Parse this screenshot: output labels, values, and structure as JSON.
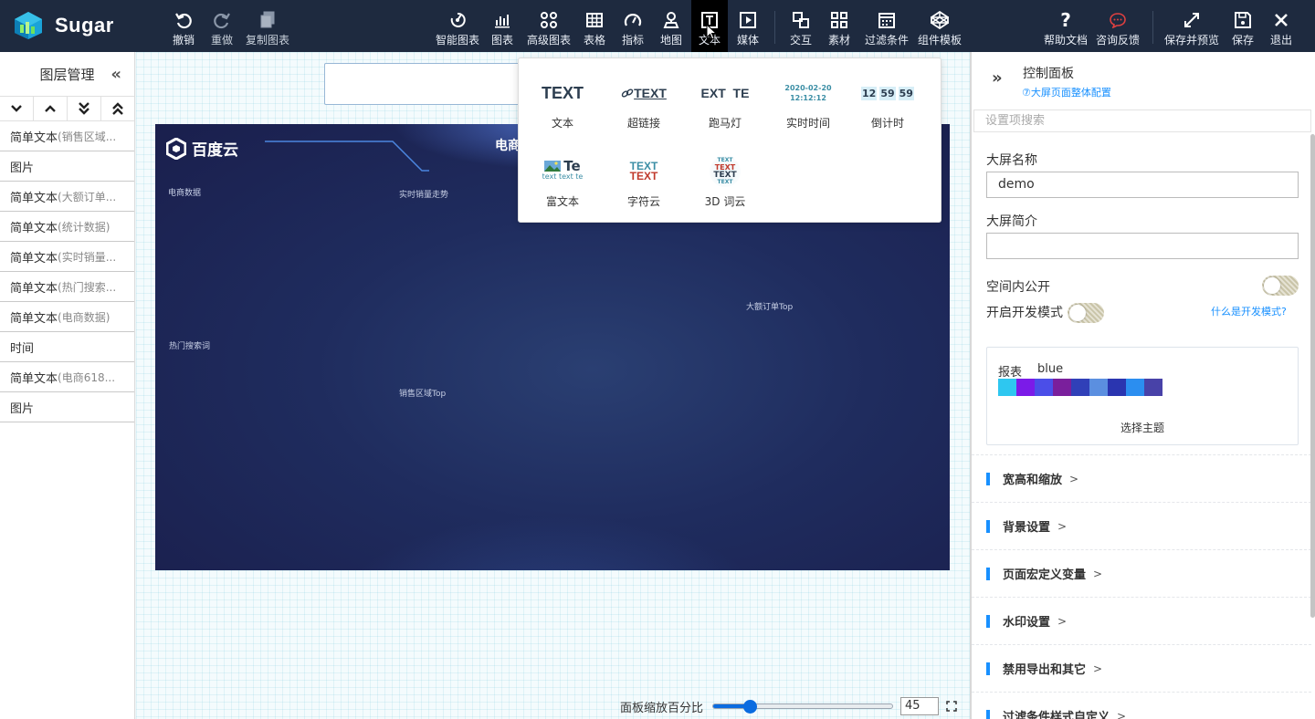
{
  "app": {
    "name": "Sugar"
  },
  "toolbar": {
    "undo": "撤销",
    "redo": "重做",
    "copy_chart": "复制图表",
    "smart_chart": "智能图表",
    "chart": "图表",
    "adv_chart": "高级图表",
    "table": "表格",
    "metric": "指标",
    "map": "地图",
    "text": "文本",
    "media": "媒体",
    "interact": "交互",
    "material": "素材",
    "filter": "过滤条件",
    "template": "组件模板",
    "help": "帮助文档",
    "feedback": "咨询反馈",
    "save_preview": "保存并预览",
    "save": "保存",
    "exit": "退出"
  },
  "layers": {
    "title": "图层管理",
    "items": [
      {
        "main": "简单文本",
        "sub": "(销售区域..."
      },
      {
        "main": "图片",
        "sub": ""
      },
      {
        "main": "简单文本",
        "sub": "(大额订单..."
      },
      {
        "main": "简单文本",
        "sub": "(统计数据)"
      },
      {
        "main": "简单文本",
        "sub": "(实时销量..."
      },
      {
        "main": "简单文本",
        "sub": "(热门搜索..."
      },
      {
        "main": "简单文本",
        "sub": "(电商数据)"
      },
      {
        "main": "时间",
        "sub": ""
      },
      {
        "main": "简单文本",
        "sub": "(电商618..."
      },
      {
        "main": "图片",
        "sub": ""
      }
    ]
  },
  "dashboard": {
    "brand": "百度云",
    "title": "电商",
    "labels": {
      "ecommerce_data": "电商数据",
      "realtime_sales": "实时销量走势",
      "big_orders": "大额订单Top",
      "hot_search": "热门搜索词",
      "sales_region": "销售区域Top"
    }
  },
  "zoom": {
    "label": "面板缩放百分比",
    "value": "45",
    "fraction": 0.45
  },
  "popup": {
    "items": [
      {
        "label": "文本",
        "preview": "TEXT"
      },
      {
        "label": "超链接",
        "preview": "TEXT"
      },
      {
        "label": "跑马灯",
        "preview": "EXT  TE"
      },
      {
        "label": "实时时间",
        "preview_date": "2020-02-20",
        "preview_time": "12:12:12"
      },
      {
        "label": "倒计时",
        "preview": [
          "12",
          "59",
          "59"
        ]
      },
      {
        "label": "富文本",
        "preview": "Te",
        "preview_sub": "text text te"
      },
      {
        "label": "字符云",
        "preview": "TEXT"
      },
      {
        "label": "3D 词云",
        "preview": "TEXT"
      }
    ]
  },
  "control": {
    "title": "控制面板",
    "subtitle": "⑦大屏页面整体配置",
    "search_placeholder": "设置项搜索",
    "screen_name_label": "大屏名称",
    "screen_name_value": "demo",
    "screen_desc_label": "大屏简介",
    "screen_desc_value": "",
    "public_label": "空间内公开",
    "dev_mode_label": "开启开发模式",
    "dev_mode_link": "什么是开发模式?",
    "theme": {
      "type": "报表",
      "name": "blue",
      "pick": "选择主题",
      "colors": [
        "#2ec7f0",
        "#7b1be8",
        "#4b4ee8",
        "#7a1f9c",
        "#3040b8",
        "#5b8fe0",
        "#2a35b0",
        "#2b8ef0",
        "#4842a8"
      ]
    },
    "sections": [
      "宽高和缩放",
      "背景设置",
      "页面宏定义变量",
      "水印设置",
      "禁用导出和其它",
      "过滤条件样式自定义"
    ]
  },
  "colors": {
    "topbar": "#1e2a3f",
    "accent": "#1890ff"
  }
}
